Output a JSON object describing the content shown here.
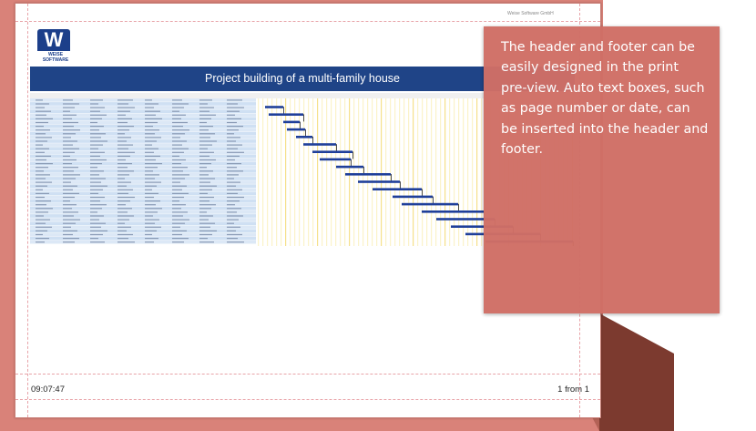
{
  "page": {
    "project_title": "Project building of a multi-family house",
    "header_right": "Weise Software GmbH",
    "logo": {
      "letter": "W",
      "line1": "WEISE",
      "line2": "SOFTWARE"
    },
    "footer_left": "09:07:47",
    "footer_right": "1 from 1"
  },
  "note": {
    "text": "The header and footer can be easily designed in the print pre-view. Auto text boxes, such as page number or date, can be inserted into the header and footer."
  },
  "colors": {
    "accent": "#d06f66",
    "title_bar": "#1f4487",
    "gantt_bar": "#1f3f9a",
    "frame": "#d98279"
  }
}
